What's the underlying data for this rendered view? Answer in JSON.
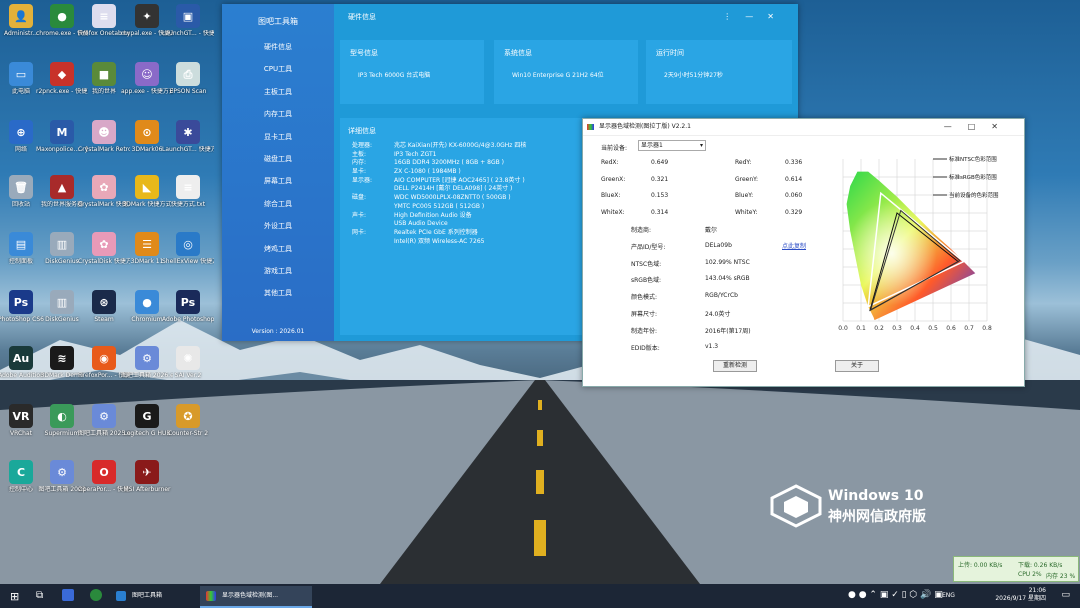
{
  "desktop_icons": [
    {
      "label": "Administr...",
      "color": "#e3b13a",
      "glyph": "👤"
    },
    {
      "label": "chrome.exe - 快捷方式",
      "color": "#2a8a3c",
      "glyph": "●"
    },
    {
      "label": "Firefox Onetab.txt",
      "color": "#dde",
      "glyph": "≡"
    },
    {
      "label": "mypal.exe - 快捷方式",
      "color": "#333",
      "glyph": "✦"
    },
    {
      "label": "LaunchGT... - 快捷方式",
      "color": "#2a5aa8",
      "glyph": "▣"
    },
    {
      "label": "此电脑",
      "color": "#3a8ad8",
      "glyph": "▭"
    },
    {
      "label": "r2pnck.exe - 快捷方式",
      "color": "#c8322a",
      "glyph": "◆"
    },
    {
      "label": "我的世界",
      "color": "#5a8a3a",
      "glyph": "■"
    },
    {
      "label": "app.exe - 快捷方式",
      "color": "#8a6ac8",
      "glyph": "☺"
    },
    {
      "label": "EPSON Scan",
      "color": "#cdd",
      "glyph": "⎙"
    },
    {
      "label": "网络",
      "color": "#2a6ac8",
      "glyph": "⊕"
    },
    {
      "label": "Maxonpolice... - 快捷方式",
      "color": "#2a5aa8",
      "glyph": "M"
    },
    {
      "label": "CrystalMark Retro 3.0...",
      "color": "#d8a8c8",
      "glyph": "☻"
    },
    {
      "label": "3DMark06",
      "color": "#e08a1a",
      "glyph": "⊙"
    },
    {
      "label": "LaunchGT... 快捷方式",
      "color": "#3a4a9a",
      "glyph": "✱"
    },
    {
      "label": "回收站",
      "color": "#9ab",
      "glyph": "🗑"
    },
    {
      "label": "我的世界服务器",
      "color": "#a82a2a",
      "glyph": "▲"
    },
    {
      "label": "CrystalMark 快捷方式",
      "color": "#e8a8b8",
      "glyph": "✿"
    },
    {
      "label": "3DMark 快捷方式",
      "color": "#e8b81a",
      "glyph": "◣"
    },
    {
      "label": "快捷方式.txt",
      "color": "#eee",
      "glyph": "≡"
    },
    {
      "label": "控制面板",
      "color": "#3a8ad8",
      "glyph": "▤"
    },
    {
      "label": "DiskGenius",
      "color": "#9ab",
      "glyph": "▥"
    },
    {
      "label": "CrystalDisk 快捷方式",
      "color": "#e89ab8",
      "glyph": "✿"
    },
    {
      "label": "3DMark 11",
      "color": "#e08a1a",
      "glyph": "☰"
    },
    {
      "label": "ShellExView 快捷方式",
      "color": "#2a7ac8",
      "glyph": "◎"
    },
    {
      "label": "PhotoShop CS6",
      "color": "#1a3a8a",
      "glyph": "Ps"
    },
    {
      "label": "DiskGenius",
      "color": "#9ab",
      "glyph": "▥"
    },
    {
      "label": "Steam",
      "color": "#1a2a4a",
      "glyph": "⊛"
    },
    {
      "label": "Chromium",
      "color": "#3a8ad8",
      "glyph": "●"
    },
    {
      "label": "Adobe Photoshop",
      "color": "#1a2a5a",
      "glyph": "Ps"
    },
    {
      "label": "Adobe Audition",
      "color": "#1a3a3a",
      "glyph": "Au"
    },
    {
      "label": "3DMark Demo",
      "color": "#1a1a1a",
      "glyph": "≋"
    },
    {
      "label": "FirefoxPor... - 快捷方式",
      "color": "#e85a1a",
      "glyph": "◉"
    },
    {
      "label": "图吧工具箱 2026.exe...",
      "color": "#6a8ad8",
      "glyph": "⚙"
    },
    {
      "label": "SAI Ver.2",
      "color": "#e8e8e8",
      "glyph": "✺"
    },
    {
      "label": "VRChat",
      "color": "#2a2a2a",
      "glyph": "VR"
    },
    {
      "label": "Supermium",
      "color": "#3a9a5a",
      "glyph": "◐"
    },
    {
      "label": "图吧工具箱 2025.exe...",
      "color": "#6a8ad8",
      "glyph": "⚙"
    },
    {
      "label": "Logitech G HUB",
      "color": "#1a1a1a",
      "glyph": "G"
    },
    {
      "label": "Counter-Str 2",
      "color": "#d89a2a",
      "glyph": "✪"
    },
    {
      "label": "控制中心",
      "color": "#1aa89a",
      "glyph": "C"
    },
    {
      "label": "图吧工具箱 2023",
      "color": "#6a8ad8",
      "glyph": "⚙"
    },
    {
      "label": "OperaPor... - 快捷方式",
      "color": "#d82a2a",
      "glyph": "O"
    },
    {
      "label": "MSI Afterburner",
      "color": "#8a1a1a",
      "glyph": "✈"
    }
  ],
  "toolbox": {
    "app_title": "图吧工具箱",
    "nav": [
      "硬件信息",
      "CPU工具",
      "主板工具",
      "内存工具",
      "显卡工具",
      "磁盘工具",
      "屏幕工具",
      "综合工具",
      "外设工具",
      "烤鸡工具",
      "游戏工具",
      "其他工具"
    ],
    "version": "Version : 2026.01",
    "page_title": "硬件信息",
    "cards": [
      {
        "header": "型号信息",
        "value": "IP3 Tech 6000G 台式电脑"
      },
      {
        "header": "系统信息",
        "value": "Win10 Enterprise G 21H2 64位"
      },
      {
        "header": "运行时间",
        "value": "2天9小时51分钟27秒"
      }
    ],
    "detail_header": "详细信息",
    "details": [
      {
        "k": "处理器:",
        "v": "兆芯 KaiXian(开先) KX-6000G/4@3.0GHz 四核"
      },
      {
        "k": "主板:",
        "v": "IP3 Tech ZGT1"
      },
      {
        "k": "内存:",
        "v": "16GB DDR4 3200MHz ( 8GB + 8GB )"
      },
      {
        "k": "显卡:",
        "v": "ZX C-1080 ( 1984MB )"
      },
      {
        "k": "显示器:",
        "v": "AIO COMPUTER [冠捷 AOC2465] ( 23.8英寸 )"
      },
      {
        "k": "",
        "v": "DELL P2414H [戴尔 DELA098] ( 24英寸 )"
      },
      {
        "k": "磁盘:",
        "v": "WDC WD5000LPLX-08ZNTT0 ( 500GB )"
      },
      {
        "k": "",
        "v": "YMTC PC005 512GB ( 512GB )"
      },
      {
        "k": "声卡:",
        "v": "High Definition Audio 设备"
      },
      {
        "k": "",
        "v": "USB Audio Device"
      },
      {
        "k": "网卡:",
        "v": "Realtek PCIe GbE 系列控制器"
      },
      {
        "k": "",
        "v": "Intel(R) 双频 Wireless-AC 7265"
      }
    ]
  },
  "gamut": {
    "title": "显示器色域检测(图拉丁版) V2.2.1",
    "device_label": "当前设备:",
    "device_value": "显示器1",
    "coords": [
      {
        "k": "RedX:",
        "v": "0.649",
        "k2": "RedY:",
        "v2": "0.336"
      },
      {
        "k": "GreenX:",
        "v": "0.321",
        "k2": "GreenY:",
        "v2": "0.614"
      },
      {
        "k": "BlueX:",
        "v": "0.153",
        "k2": "BlueY:",
        "v2": "0.060"
      },
      {
        "k": "WhiteX:",
        "v": "0.314",
        "k2": "WhiteY:",
        "v2": "0.329"
      }
    ],
    "info": [
      {
        "k": "制造商:",
        "v": "戴尔"
      },
      {
        "k": "产品ID/型号:",
        "v": "DELa09b"
      },
      {
        "k": "NTSC色域:",
        "v": "102.99% NTSC"
      },
      {
        "k": "sRGB色域:",
        "v": "143.04% sRGB"
      },
      {
        "k": "颜色模式:",
        "v": "RGB/YCrCb"
      },
      {
        "k": "屏幕尺寸:",
        "v": "24.0英寸"
      },
      {
        "k": "制造年份:",
        "v": "2016年(第17周)"
      },
      {
        "k": "EDID版本:",
        "v": "v1.3"
      }
    ],
    "copy_link": "点此复制",
    "redetect_button": "重新检测",
    "close_button": "关于",
    "legend": [
      "标准NTSC色彩范围",
      "标准sRGB色彩范围",
      "当前设备的色彩范围"
    ],
    "ticks": [
      "0.0",
      "0.1",
      "0.2",
      "0.3",
      "0.4",
      "0.5",
      "0.6",
      "0.7",
      "0.8"
    ]
  },
  "watermark": {
    "line1": "Windows 10",
    "line2": "神州网信政府版"
  },
  "taskbar": {
    "tasks": [
      "图吧工具箱",
      "显示器色域检测(图..."
    ],
    "tray": "ENG",
    "time": "21:06",
    "date": "2026/9/17 星期四"
  },
  "net": {
    "up": "上传: 0.00 KB/s",
    "down": "下载: 0.26 KB/s",
    "cpu": "CPU 2%",
    "mem": "内存 23 %"
  }
}
